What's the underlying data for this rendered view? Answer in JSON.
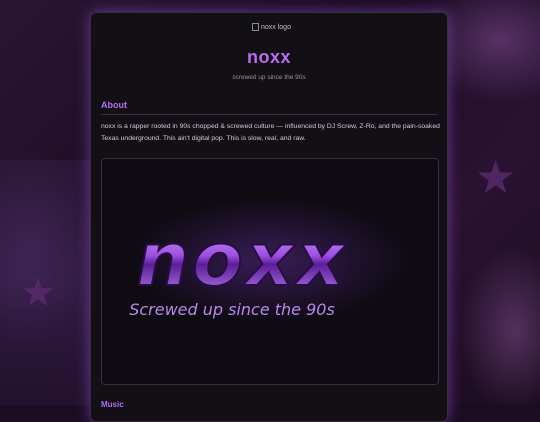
{
  "background": {
    "accent": "#b56cf0",
    "star_icon": "star-icon"
  },
  "header": {
    "logo_alt": "noxx logo",
    "title": "noxx",
    "subtitle": "screwed up since the 90s"
  },
  "about": {
    "heading": "About",
    "body": "noxx is a rapper rooted in 90s chopped & screwed culture — influenced by DJ Screw, Z-Ro, and the pain-soaked Texas underground. This ain't digital pop. This is slow, real, and raw."
  },
  "banner": {
    "logo_text": "noxx",
    "tagline": "Screwed up since the 90s"
  },
  "next_section": {
    "heading": "Music"
  }
}
